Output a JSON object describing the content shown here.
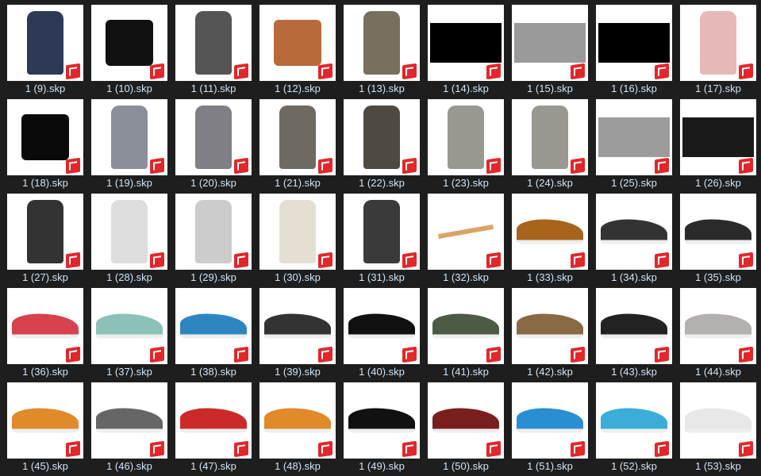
{
  "files": [
    {
      "name": "1 (9).skp",
      "kind": "clothing",
      "color": "#2e3a55"
    },
    {
      "name": "1 (10).skp",
      "kind": "bag",
      "color": "#111111"
    },
    {
      "name": "1 (11).skp",
      "kind": "clothing",
      "color": "#555555"
    },
    {
      "name": "1 (12).skp",
      "kind": "bag",
      "color": "#b86a3a"
    },
    {
      "name": "1 (13).skp",
      "kind": "clothing",
      "color": "#77705f"
    },
    {
      "name": "1 (14).skp",
      "kind": "texture",
      "color": "#000000"
    },
    {
      "name": "1 (15).skp",
      "kind": "texture",
      "color": "#9a9a9a"
    },
    {
      "name": "1 (16).skp",
      "kind": "texture",
      "color": "#000000"
    },
    {
      "name": "1 (17).skp",
      "kind": "clothing",
      "color": "#e6b8b8"
    },
    {
      "name": "1 (18).skp",
      "kind": "bag",
      "color": "#0a0a0a"
    },
    {
      "name": "1 (19).skp",
      "kind": "clothing",
      "color": "#8a8f99"
    },
    {
      "name": "1 (20).skp",
      "kind": "clothing",
      "color": "#7f7f85"
    },
    {
      "name": "1 (21).skp",
      "kind": "clothing",
      "color": "#6e6a62"
    },
    {
      "name": "1 (22).skp",
      "kind": "clothing",
      "color": "#4e4a42"
    },
    {
      "name": "1 (23).skp",
      "kind": "clothing",
      "color": "#9a9890"
    },
    {
      "name": "1 (24).skp",
      "kind": "clothing",
      "color": "#9a9890"
    },
    {
      "name": "1 (25).skp",
      "kind": "texture",
      "color": "#9c9c9c"
    },
    {
      "name": "1 (26).skp",
      "kind": "texture",
      "color": "#1a1a1a"
    },
    {
      "name": "1 (27).skp",
      "kind": "clothing",
      "color": "#333333"
    },
    {
      "name": "1 (28).skp",
      "kind": "clothing",
      "color": "#dddddd"
    },
    {
      "name": "1 (29).skp",
      "kind": "clothing",
      "color": "#cccccc"
    },
    {
      "name": "1 (30).skp",
      "kind": "clothing",
      "color": "#e4dfd2"
    },
    {
      "name": "1 (31).skp",
      "kind": "clothing",
      "color": "#3a3a3a"
    },
    {
      "name": "1 (32).skp",
      "kind": "hanger",
      "color": "#d9a46a"
    },
    {
      "name": "1 (33).skp",
      "kind": "shoe",
      "color": "#a8641a"
    },
    {
      "name": "1 (34).skp",
      "kind": "shoe",
      "color": "#333333"
    },
    {
      "name": "1 (35).skp",
      "kind": "shoe",
      "color": "#2a2a2a"
    },
    {
      "name": "1 (36).skp",
      "kind": "shoe",
      "color": "#d8414f"
    },
    {
      "name": "1 (37).skp",
      "kind": "shoe",
      "color": "#8cc1b8"
    },
    {
      "name": "1 (38).skp",
      "kind": "shoe",
      "color": "#2e86c1"
    },
    {
      "name": "1 (39).skp",
      "kind": "shoe",
      "color": "#333333"
    },
    {
      "name": "1 (40).skp",
      "kind": "shoe",
      "color": "#111111"
    },
    {
      "name": "1 (41).skp",
      "kind": "shoe",
      "color": "#4d5a45"
    },
    {
      "name": "1 (42).skp",
      "kind": "shoe",
      "color": "#8a6a45"
    },
    {
      "name": "1 (43).skp",
      "kind": "shoe",
      "color": "#222222"
    },
    {
      "name": "1 (44).skp",
      "kind": "shoe",
      "color": "#b5b0b0"
    },
    {
      "name": "1 (45).skp",
      "kind": "shoe",
      "color": "#e08a2a"
    },
    {
      "name": "1 (46).skp",
      "kind": "shoe",
      "color": "#666666"
    },
    {
      "name": "1 (47).skp",
      "kind": "shoe",
      "color": "#cc2a2a"
    },
    {
      "name": "1 (48).skp",
      "kind": "shoe",
      "color": "#e08a2a"
    },
    {
      "name": "1 (49).skp",
      "kind": "shoe",
      "color": "#111111"
    },
    {
      "name": "1 (50).skp",
      "kind": "shoe",
      "color": "#7a1e1e"
    },
    {
      "name": "1 (51).skp",
      "kind": "shoe",
      "color": "#2a8fd0"
    },
    {
      "name": "1 (52).skp",
      "kind": "shoe",
      "color": "#3aaed8"
    },
    {
      "name": "1 (53).skp",
      "kind": "shoe",
      "color": "#e8e8e8"
    }
  ]
}
